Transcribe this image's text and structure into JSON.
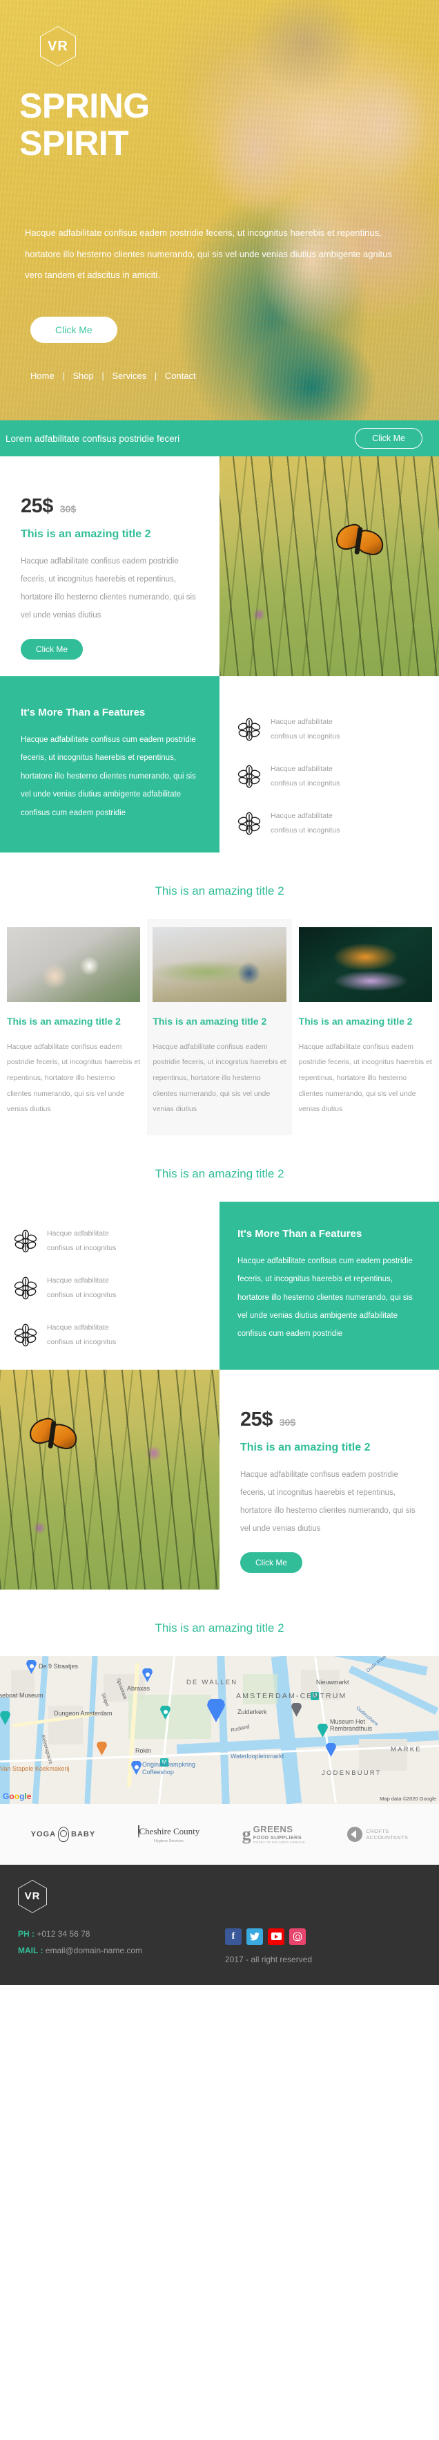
{
  "brand": {
    "logo_text": "VR"
  },
  "hero": {
    "title_line1": "SPRING",
    "title_line2": "SPIRIT",
    "paragraph": "Hacque adfabilitate confisus eadem postridie feceris, ut incognitus haerebis et repentinus, hortatore illo hesterno clientes numerando, qui sis vel unde venias diutius ambigente agnitus vero tandem et adscitus in amiciti.",
    "button_label": "Click Me",
    "nav": [
      {
        "label": "Home"
      },
      {
        "label": "Shop"
      },
      {
        "label": "Services"
      },
      {
        "label": "Contact"
      }
    ],
    "nav_separator": "|"
  },
  "cta_bar": {
    "text": "Lorem adfabilitate confisus postridie feceri",
    "button_label": "Click Me"
  },
  "price_block_top": {
    "price_new": "25$",
    "price_old": "30$",
    "title": "This is an amazing title 2",
    "body": "Hacque adfabilitate confisus eadem postridie feceris, ut incognitus haerebis et repentinus, hortatore illo hesterno clientes numerando, qui sis vel unde venias diutius",
    "button_label": "Click Me"
  },
  "features_top": {
    "heading": "It's More Than a Features",
    "body": "Hacque adfabilitate confisus cum eadem postridie feceris, ut incognitus haerebis et repentinus, hortatore illo hesterno clientes numerando, qui sis vel unde venias diutius ambigente adfabilitate confisus cum eadem postridie",
    "items": [
      {
        "icon": "flower-icon",
        "line1": "Hacque adfabilitate",
        "line2": "confisus ut incognitus"
      },
      {
        "icon": "flower-icon",
        "line1": "Hacque adfabilitate",
        "line2": "confisus ut incognitus"
      },
      {
        "icon": "flower-icon",
        "line1": "Hacque adfabilitate",
        "line2": "confisus ut incognitus"
      }
    ]
  },
  "cards_section": {
    "title": "This is an amazing title 2",
    "cards": [
      {
        "image": "hand-holding-blossom",
        "title": "This is an amazing title 2",
        "body": "Hacque adfabilitate confisus eadem postridie feceris, ut incognitus haerebis et repentinus, hortatore illo hesterno clientes numerando, qui sis vel unde venias diutius"
      },
      {
        "image": "woman-smelling-blossom",
        "title": "This is an amazing title 2",
        "body": "Hacque adfabilitate confisus eadem postridie feceris, ut incognitus haerebis et repentinus, hortatore illo hesterno clientes numerando, qui sis vel unde venias diutius"
      },
      {
        "image": "butterfly-on-lavender",
        "title": "This is an amazing title 2",
        "body": "Hacque adfabilitate confisus eadem postridie feceris, ut incognitus haerebis et repentinus, hortatore illo hesterno clientes numerando, qui sis vel unde venias diutius"
      }
    ]
  },
  "features_bottom": {
    "title": "This is an amazing title 2",
    "heading": "It's More Than a Features",
    "body": "Hacque adfabilitate confisus cum eadem postridie feceris, ut incognitus haerebis et repentinus, hortatore illo hesterno clientes numerando, qui sis vel unde venias diutius ambigente adfabilitate confisus cum eadem postridie",
    "items": [
      {
        "icon": "flower-icon",
        "line1": "Hacque adfabilitate",
        "line2": "confisus ut incognitus"
      },
      {
        "icon": "flower-icon",
        "line1": "Hacque adfabilitate",
        "line2": "confisus ut incognitus"
      },
      {
        "icon": "flower-icon",
        "line1": "Hacque adfabilitate",
        "line2": "confisus ut incognitus"
      }
    ]
  },
  "price_block_bottom": {
    "price_new": "25$",
    "price_old": "30$",
    "title": "This is an amazing title 2",
    "body": "Hacque adfabilitate confisus eadem postridie feceris, ut incognitus haerebis et repentinus, hortatore illo hesterno clientes numerando, qui sis vel unde venias diutius",
    "button_label": "Click Me"
  },
  "map_section": {
    "title": "This is an amazing title 2",
    "labels": [
      {
        "text": "De 9 Straatjes"
      },
      {
        "text": "Abraxas"
      },
      {
        "text": "DE WALLEN"
      },
      {
        "text": "Nieuwmarkt"
      },
      {
        "text": "AMSTERDAM-CENTRUM"
      },
      {
        "text": "Houseboat Museum"
      },
      {
        "text": "Dungeon Amsterdam"
      },
      {
        "text": "Zuiderkerk"
      },
      {
        "text": "Museum Het Rembrandthuis"
      },
      {
        "text": "Rokin"
      },
      {
        "text": "Van Stapele Koekmakerij"
      },
      {
        "text": "Original Dampkring Coffeeshop"
      },
      {
        "text": "Waterloopleinmarkt"
      },
      {
        "text": "JODENBUURT"
      },
      {
        "text": "MARKE"
      },
      {
        "text": "Oude Waal"
      },
      {
        "text": "Oudeschans"
      },
      {
        "text": "Singel"
      },
      {
        "text": "Spuistraat"
      },
      {
        "text": "Keizersgracht"
      },
      {
        "text": "Rusland"
      }
    ],
    "attribution": "Map data ©2020 Google",
    "google_wordmark": "Google"
  },
  "client_logos": [
    {
      "name": "YOGA BABY",
      "part1": "YOGA",
      "part2": "BABY"
    },
    {
      "name": "Cheshire County",
      "main": "Cheshire County",
      "sub": "Hygiene Services"
    },
    {
      "name": "GREENS FOOD SUPPLIERS",
      "mark": "g",
      "line1": "GREENS",
      "line2": "FOOD SUPPLIERS",
      "line3": "FINEST OF DELIVERY SERVICE"
    },
    {
      "name": "CROFTS ACCOUNTANTS",
      "line1": "CROFTS",
      "line2": "ACCOUNTANTS"
    }
  ],
  "footer": {
    "logo_text": "VR",
    "phone_label": "PH :",
    "phone_value": "+012 34 56 78",
    "mail_label": "MAIL :",
    "mail_value": "email@domain-name.com",
    "copyright": "2017 - all right reserved",
    "socials": [
      {
        "name": "facebook-icon",
        "glyph": "f"
      },
      {
        "name": "twitter-icon",
        "glyph": ""
      },
      {
        "name": "youtube-icon",
        "glyph": ""
      },
      {
        "name": "instagram-icon",
        "glyph": ""
      }
    ]
  },
  "colors": {
    "accent": "#31bd98",
    "hero_bg": "#e5c44f",
    "footer_bg": "#333333",
    "muted": "#9b9b9b"
  }
}
